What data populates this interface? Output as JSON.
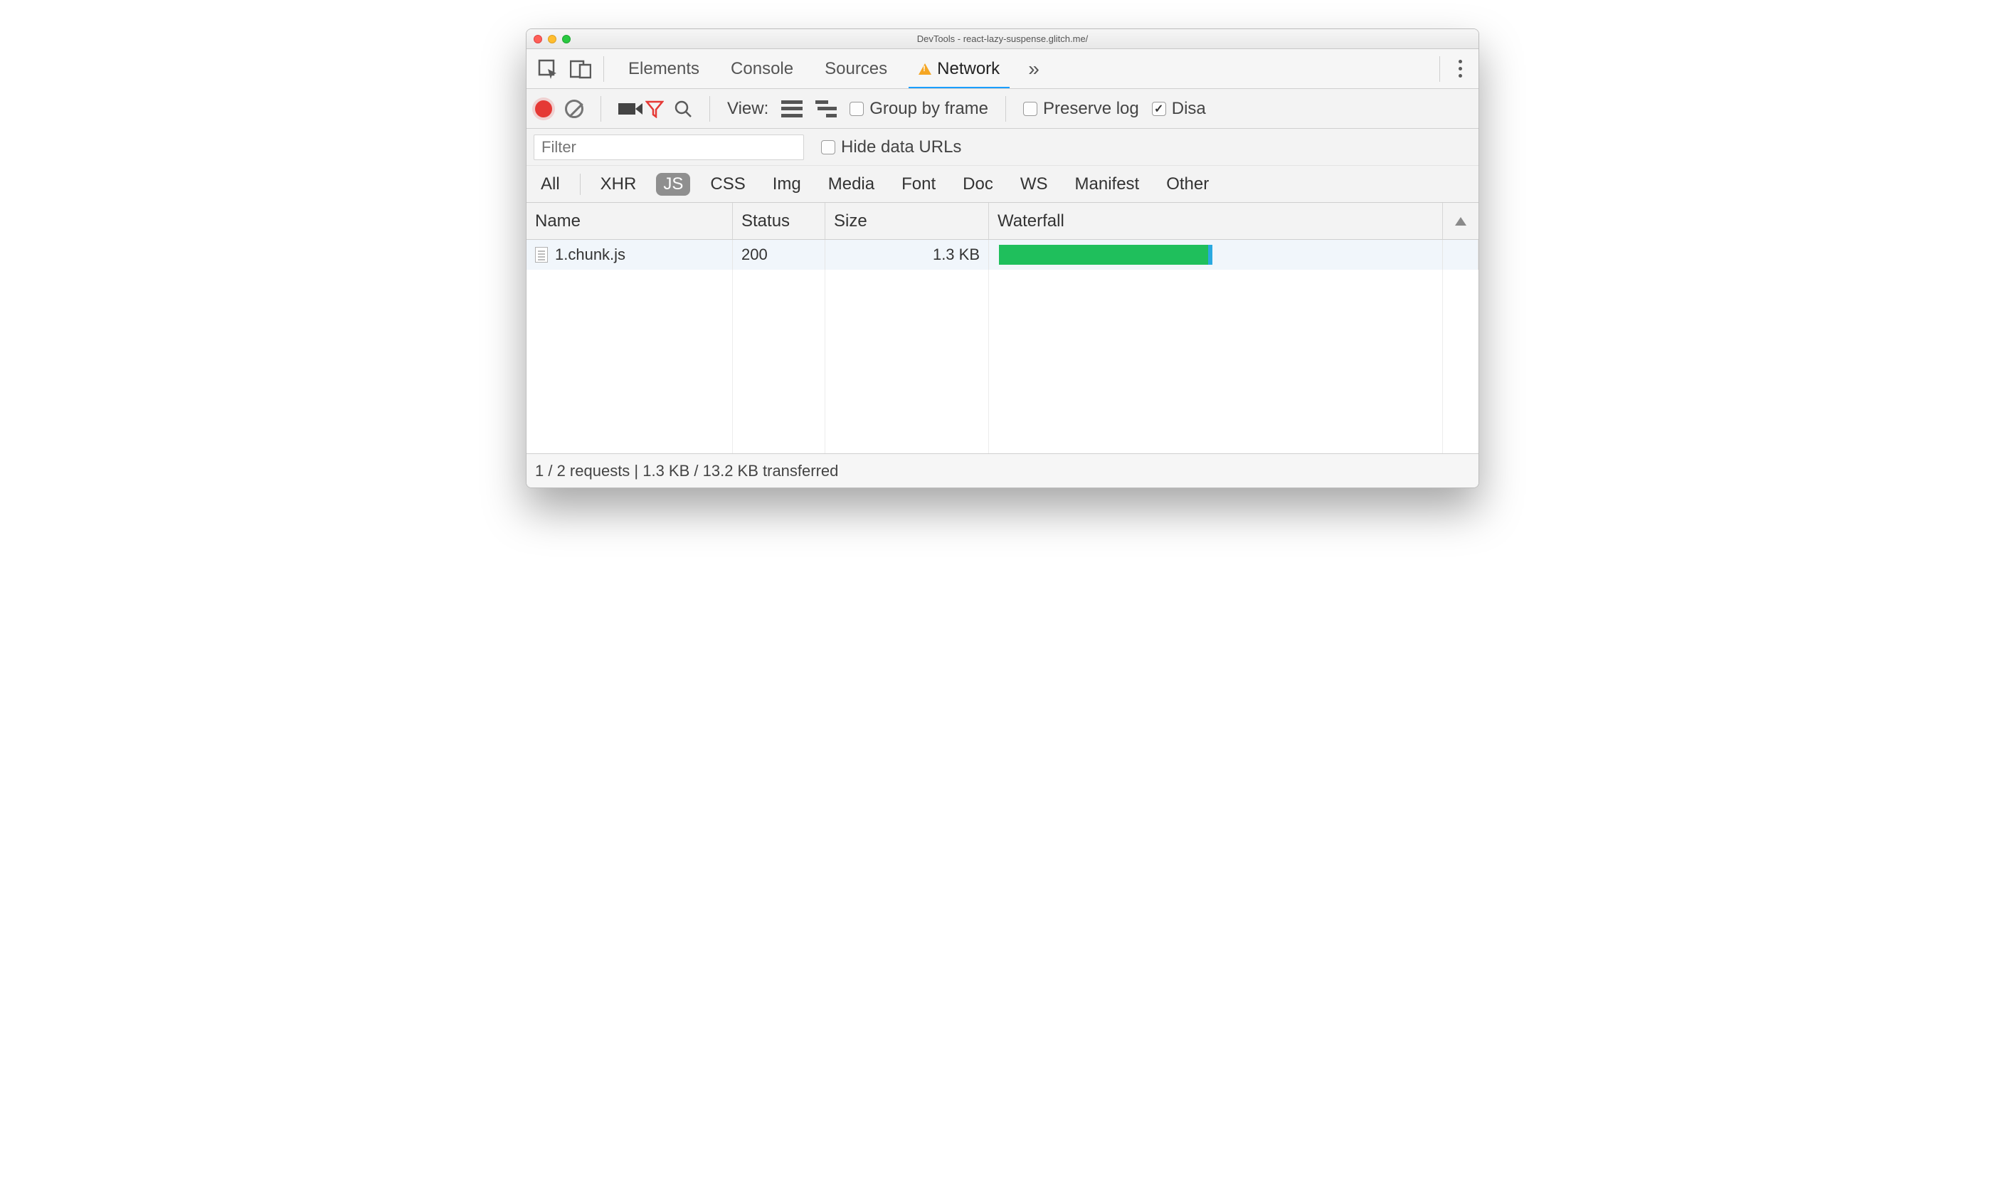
{
  "window": {
    "title": "DevTools - react-lazy-suspense.glitch.me/"
  },
  "tabs": {
    "items": [
      "Elements",
      "Console",
      "Sources",
      "Network"
    ],
    "active": "Network"
  },
  "toolbar": {
    "view_label": "View:",
    "group_by_frame": "Group by frame",
    "preserve_log": "Preserve log",
    "disable_cache": "Disa"
  },
  "filter": {
    "placeholder": "Filter",
    "hide_data_urls": "Hide data URLs"
  },
  "types": {
    "items": [
      "All",
      "XHR",
      "JS",
      "CSS",
      "Img",
      "Media",
      "Font",
      "Doc",
      "WS",
      "Manifest",
      "Other"
    ],
    "active": "JS"
  },
  "table": {
    "headers": {
      "name": "Name",
      "status": "Status",
      "size": "Size",
      "waterfall": "Waterfall"
    },
    "rows": [
      {
        "name": "1.chunk.js",
        "status": "200",
        "size": "1.3 KB"
      }
    ]
  },
  "footer": {
    "summary": "1 / 2 requests | 1.3 KB / 13.2 KB transferred"
  }
}
